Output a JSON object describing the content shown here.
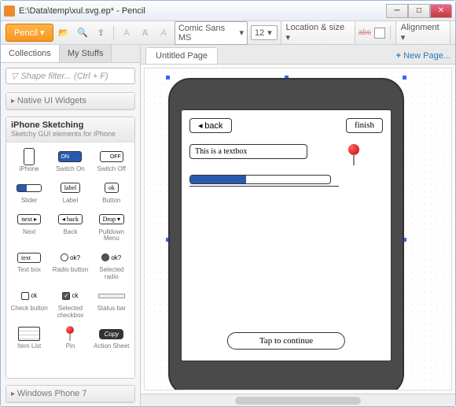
{
  "window": {
    "title": "E:\\Data\\temp\\xul.svg.ep* - Pencil",
    "app": "Pencil"
  },
  "toolbar": {
    "menu_label": "Pencil",
    "font_family": "Comic Sans MS",
    "font_size": "12",
    "loc_size": "Location & size",
    "alignment": "Alignment",
    "strike": "abc"
  },
  "sidebar": {
    "tabs": [
      "Collections",
      "My Stuffs"
    ],
    "filter_placeholder": "Shape filter... (Ctrl + F)",
    "collapsed_group": "Native UI Widgets",
    "active_group": {
      "title": "iPhone Sketching",
      "subtitle": "Sketchy GUI elements for iPhone"
    },
    "stencils": [
      {
        "label": "iPhone",
        "prev": "phone"
      },
      {
        "label": "Switch On",
        "prev": "switch-on",
        "text": "ON"
      },
      {
        "label": "Switch Off",
        "prev": "switch-off",
        "text": "OFF"
      },
      {
        "label": "Slider",
        "prev": "slider"
      },
      {
        "label": "Label",
        "prev": "label",
        "text": "label"
      },
      {
        "label": "Button",
        "prev": "button",
        "text": "ok"
      },
      {
        "label": "Next",
        "prev": "next",
        "text": "next"
      },
      {
        "label": "Back",
        "prev": "back",
        "text": "back"
      },
      {
        "label": "Pulldown Menu",
        "prev": "drop",
        "text": "Drop"
      },
      {
        "label": "Text box",
        "prev": "text",
        "text": "text"
      },
      {
        "label": "Radio button",
        "prev": "radio",
        "text": "ok?"
      },
      {
        "label": "Selected radio",
        "prev": "radio-sel",
        "text": "ok?"
      },
      {
        "label": "Check button",
        "prev": "check",
        "text": "ck"
      },
      {
        "label": "Selected checkbox",
        "prev": "check-sel",
        "text": "ck"
      },
      {
        "label": "Status bar",
        "prev": "status"
      },
      {
        "label": "Item List",
        "prev": "list"
      },
      {
        "label": "Pin",
        "prev": "pin"
      },
      {
        "label": "Action Sheet",
        "prev": "action",
        "text": "Copy"
      }
    ],
    "collapsed_group2": "Windows Phone 7"
  },
  "canvas": {
    "page_tab": "Untitled Page",
    "new_page": "New Page...",
    "mockup": {
      "back": "back",
      "finish": "finish",
      "textbox": "This is a textbox",
      "tap": "Tap to continue"
    }
  }
}
